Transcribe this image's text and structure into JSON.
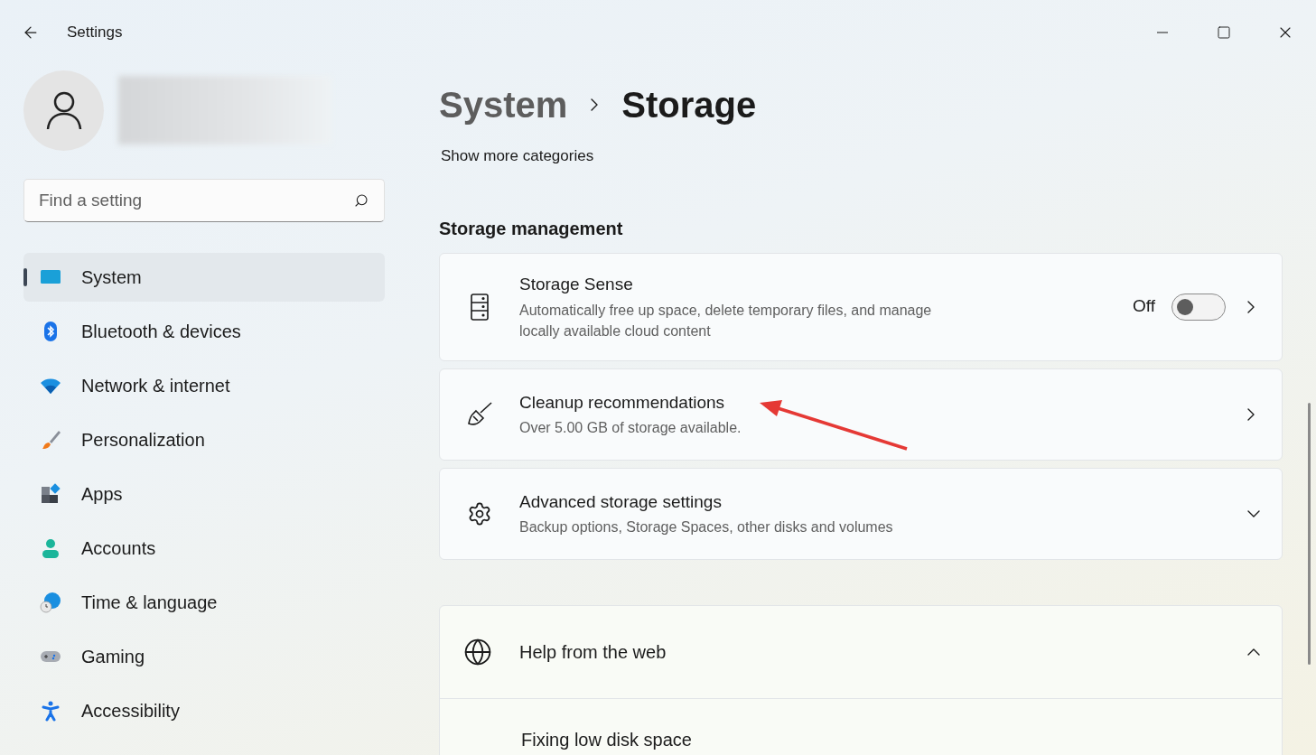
{
  "window": {
    "title": "Settings"
  },
  "search": {
    "placeholder": "Find a setting"
  },
  "sidebar": {
    "items": [
      {
        "label": "System",
        "selected": true
      },
      {
        "label": "Bluetooth & devices",
        "selected": false
      },
      {
        "label": "Network & internet",
        "selected": false
      },
      {
        "label": "Personalization",
        "selected": false
      },
      {
        "label": "Apps",
        "selected": false
      },
      {
        "label": "Accounts",
        "selected": false
      },
      {
        "label": "Time & language",
        "selected": false
      },
      {
        "label": "Gaming",
        "selected": false
      },
      {
        "label": "Accessibility",
        "selected": false
      }
    ]
  },
  "breadcrumb": {
    "parent": "System",
    "current": "Storage"
  },
  "show_more": "Show more categories",
  "section_title": "Storage management",
  "settings": [
    {
      "kind": "toggle",
      "title": "Storage Sense",
      "description": "Automatically free up space, delete temporary files, and manage locally available cloud content",
      "state_label": "Off",
      "on": false
    },
    {
      "kind": "link",
      "title": "Cleanup recommendations",
      "description": "Over 5.00 GB of storage available."
    },
    {
      "kind": "expander",
      "title": "Advanced storage settings",
      "description": "Backup options, Storage Spaces, other disks and volumes",
      "expanded": false
    }
  ],
  "help": {
    "title": "Help from the web",
    "expanded": true,
    "links": [
      "Fixing low disk space"
    ]
  }
}
